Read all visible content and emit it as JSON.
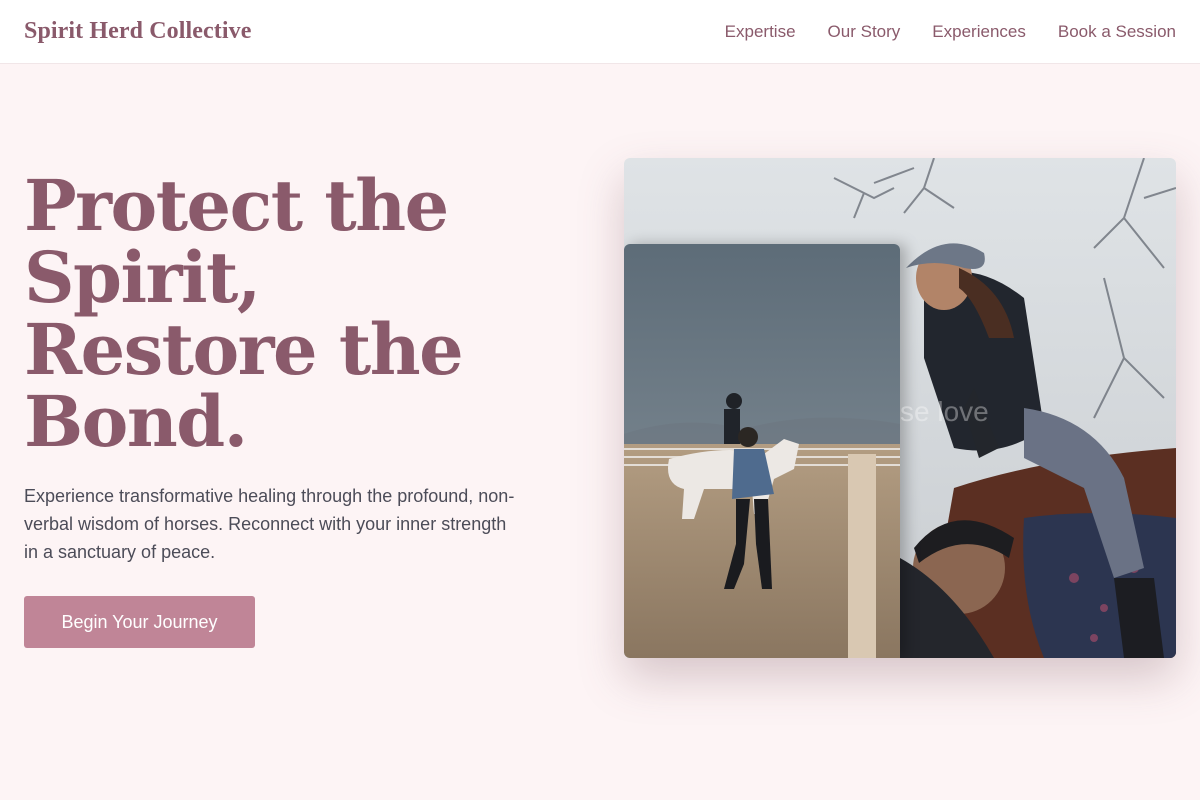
{
  "brand": {
    "name": "Spirit Herd Collective"
  },
  "nav": {
    "items": [
      {
        "label": "Expertise"
      },
      {
        "label": "Our Story"
      },
      {
        "label": "Experiences"
      },
      {
        "label": "Book a Session"
      }
    ]
  },
  "hero": {
    "headline_lines": [
      "Protect the",
      "Spirit,",
      "Restore the",
      "Bond."
    ],
    "subtext": "Experience transformative healing through the profound, non-verbal wisdom of horses. Reconnect with your inner strength in a sanctuary of peace.",
    "cta_label": "Begin Your Journey",
    "watermark": "se love"
  },
  "colors": {
    "background": "#fdf4f5",
    "brand": "#8a5a6b",
    "cta": "#c08597",
    "body_text": "#4c4c58"
  },
  "images": [
    {
      "name": "arena-horse-photo"
    },
    {
      "name": "rider-with-horse-photo"
    }
  ]
}
